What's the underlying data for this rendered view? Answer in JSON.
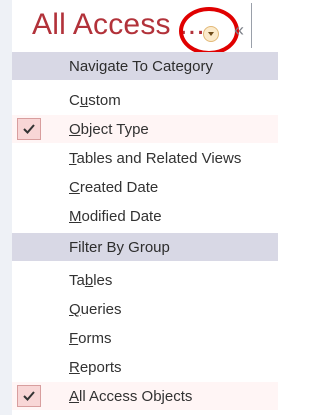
{
  "header": {
    "title": "All Access ...",
    "menu_arrow_icon": "dropdown-arrow-icon",
    "collapse_icon": "collapse-double-chevron-icon"
  },
  "menu": {
    "sections": [
      {
        "label": "Navigate To Category"
      },
      {
        "label": "Filter By Group"
      }
    ],
    "category_items": [
      {
        "label": "Custom",
        "checked": false,
        "mnemonic_index": 1
      },
      {
        "label": "Object Type",
        "checked": true,
        "mnemonic_index": 0
      },
      {
        "label": "Tables and Related Views",
        "checked": false,
        "mnemonic_index": 0
      },
      {
        "label": "Created Date",
        "checked": false,
        "mnemonic_index": 0
      },
      {
        "label": "Modified Date",
        "checked": false,
        "mnemonic_index": 0
      }
    ],
    "group_items": [
      {
        "label": "Tables",
        "checked": false,
        "mnemonic_index": 2
      },
      {
        "label": "Queries",
        "checked": false,
        "mnemonic_index": 0
      },
      {
        "label": "Forms",
        "checked": false,
        "mnemonic_index": 0
      },
      {
        "label": "Reports",
        "checked": false,
        "mnemonic_index": 0
      },
      {
        "label": "All Access Objects",
        "checked": true,
        "mnemonic_index": 0
      }
    ]
  },
  "colors": {
    "title": "#b2323a",
    "section_background": "#d8d8e5",
    "check_background": "#f8d6d6",
    "annotation_circle": "#e00000"
  }
}
